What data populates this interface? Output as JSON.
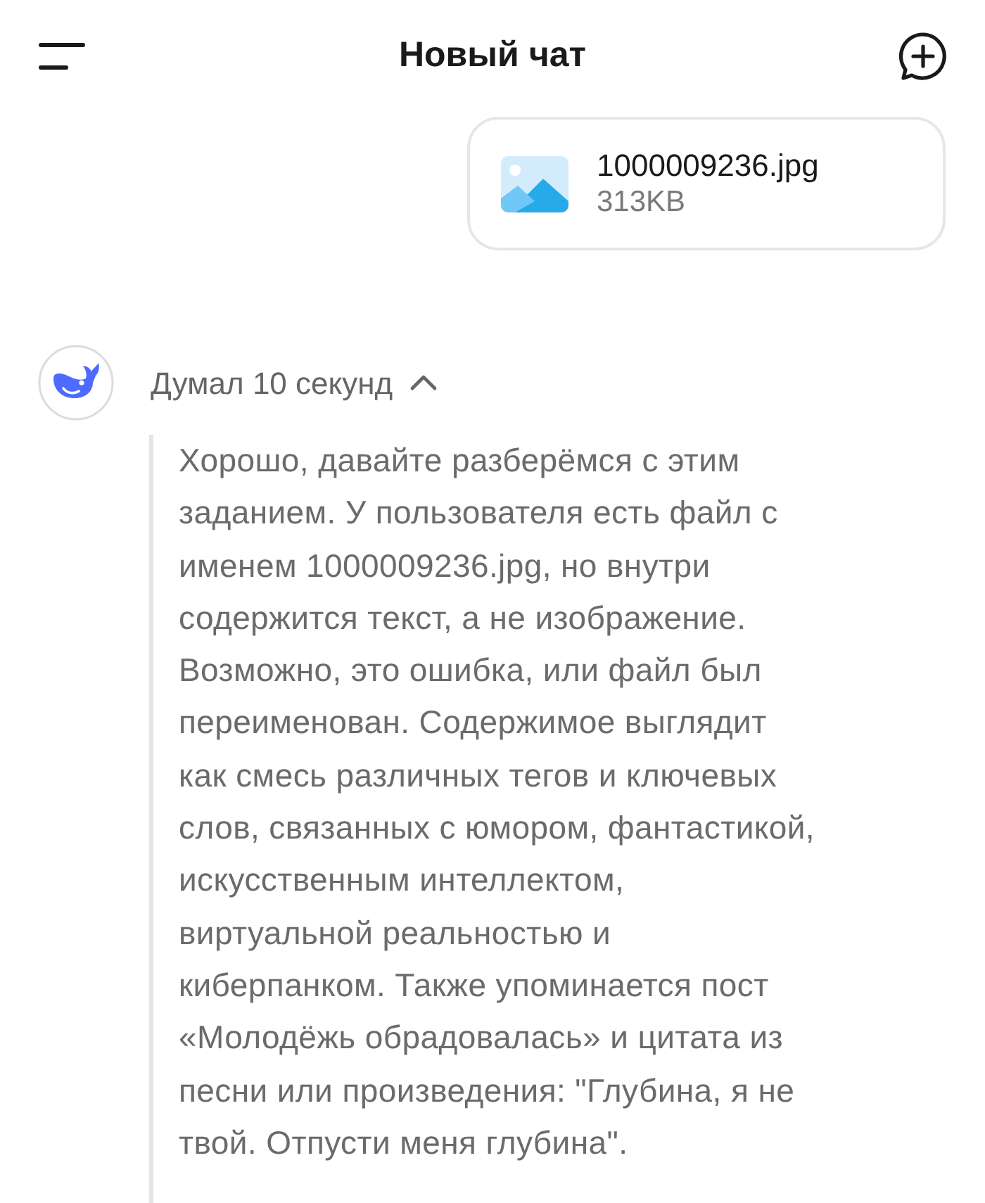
{
  "header": {
    "title": "Новый чат"
  },
  "attachment": {
    "file_name": "1000009236.jpg",
    "file_size": "313KB"
  },
  "reply": {
    "thinking_label": "Думал 10 секунд",
    "expanded": true,
    "thinking_lines": [
      "Хорошо, давайте разберёмся с этим",
      "заданием. У пользователя есть файл с",
      "именем 1000009236.jpg, но внутри",
      "содержится текст, а не изображение.",
      "Возможно, это ошибка, или файл был",
      "переименован. Содержимое выглядит",
      "как смесь различных тегов и ключевых",
      "слов, связанных с юмором, фантастикой,",
      "искусственным интеллектом,",
      "виртуальной реальностью и",
      "киберпанком. Также упоминается пост",
      "«Молодёжь обрадовалась» и цитата из",
      "песни или произведения: \"Глубина, я не",
      "твой. Отпусти меня глубина\"."
    ]
  }
}
